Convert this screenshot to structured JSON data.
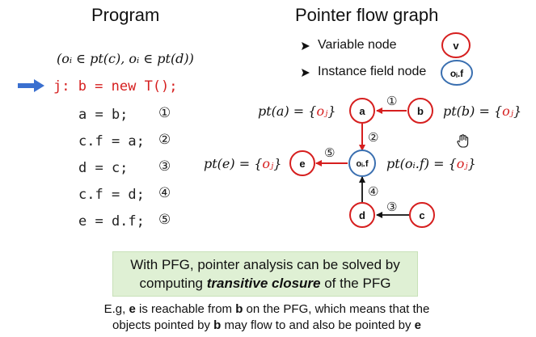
{
  "headers": {
    "program": "Program",
    "pfg": "Pointer flow graph"
  },
  "condition": "(oᵢ ∈ pt(c), oᵢ ∈ pt(d))",
  "code": [
    {
      "text": "j: b = new T();",
      "num": ""
    },
    {
      "text": "a = b;",
      "num": "①"
    },
    {
      "text": "c.f = a;",
      "num": "②"
    },
    {
      "text": "d = c;",
      "num": "③"
    },
    {
      "text": "c.f = d;",
      "num": "④"
    },
    {
      "text": "e = d.f;",
      "num": "⑤"
    }
  ],
  "legend": {
    "variable": "Variable node",
    "variable_symbol": "v",
    "field": "Instance field node",
    "field_symbol": "oᵢ.f"
  },
  "nodes": {
    "a": "a",
    "b": "b",
    "c": "c",
    "d": "d",
    "e": "e",
    "of": "oᵢ.f"
  },
  "edges": {
    "1": "①",
    "2": "②",
    "3": "③",
    "4": "④",
    "5": "⑤"
  },
  "pt": {
    "a": {
      "left": "pt(a) = {",
      "obj": "oⱼ",
      "right": "}"
    },
    "b": {
      "left": "pt(b) = {",
      "obj": "oⱼ",
      "right": "}"
    },
    "e": {
      "left": "pt(e) = {",
      "obj": "oⱼ",
      "right": "}"
    },
    "of": {
      "left": "pt(oᵢ.f) = {",
      "obj": "oⱼ",
      "right": "}"
    }
  },
  "banner": {
    "line1": "With PFG, pointer analysis can be solved by",
    "line2_pre": "computing ",
    "line2_em": "transitive closure",
    "line2_post": " of the PFG"
  },
  "footer": {
    "p1": "E.g, ",
    "b1": "e",
    "p2": " is reachable from ",
    "b2": "b",
    "p3": " on the PFG, which means that the",
    "p4": "objects pointed by ",
    "b3": "b",
    "p5": " may flow to and also be pointed by ",
    "b4": "e"
  },
  "colors": {
    "red": "#d61f1f",
    "node_blue": "#3a6fb0",
    "arrow_blue": "#3a6fcf",
    "banner_bg": "#dff0d4"
  },
  "icons": {
    "pointer": "blue-right-arrow-icon",
    "bullet": "triangle-bullet-icon",
    "cursor": "hand-cursor-icon"
  }
}
